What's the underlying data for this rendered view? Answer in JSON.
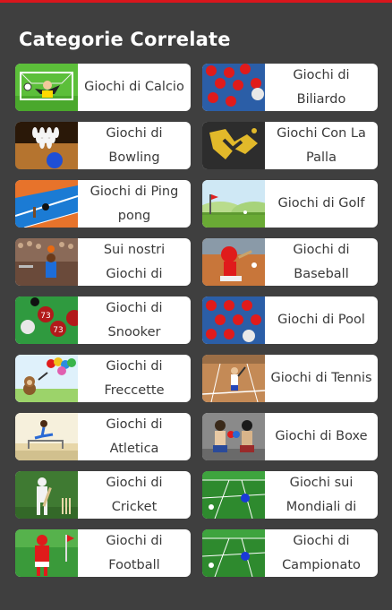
{
  "section": {
    "title": "Categorie Correlate"
  },
  "categories": [
    {
      "label": "Giochi di Calcio",
      "icon": "soccer-goalkeeper-icon"
    },
    {
      "label": "Giochi di Biliardo",
      "icon": "billiard-balls-icon"
    },
    {
      "label": "Giochi di Bowling",
      "icon": "bowling-pins-icon"
    },
    {
      "label": "Giochi Con La Palla",
      "icon": "snake-ball-icon"
    },
    {
      "label": "Giochi di Ping pong",
      "icon": "ping-pong-table-icon"
    },
    {
      "label": "Giochi di Golf",
      "icon": "golf-course-icon"
    },
    {
      "label": "Sui nostri Giochi di",
      "icon": "basketball-player-icon"
    },
    {
      "label": "Giochi di Baseball",
      "icon": "baseball-player-icon"
    },
    {
      "label": "Giochi di Snooker",
      "icon": "snooker-balls-icon"
    },
    {
      "label": "Giochi di Pool",
      "icon": "pool-balls-icon"
    },
    {
      "label": "Giochi di Freccette",
      "icon": "darts-monkey-balloons-icon"
    },
    {
      "label": "Giochi di Tennis",
      "icon": "tennis-player-icon"
    },
    {
      "label": "Giochi di Atletica",
      "icon": "hurdler-icon"
    },
    {
      "label": "Giochi di Boxe",
      "icon": "boxers-icon"
    },
    {
      "label": "Giochi di Cricket",
      "icon": "cricket-batsman-icon"
    },
    {
      "label": "Giochi sui Mondiali di",
      "icon": "world-cup-soccer-field-icon"
    },
    {
      "label": "Giochi di Football",
      "icon": "football-player-icon"
    },
    {
      "label": "Giochi di Campionato",
      "icon": "championship-soccer-field-icon"
    }
  ]
}
